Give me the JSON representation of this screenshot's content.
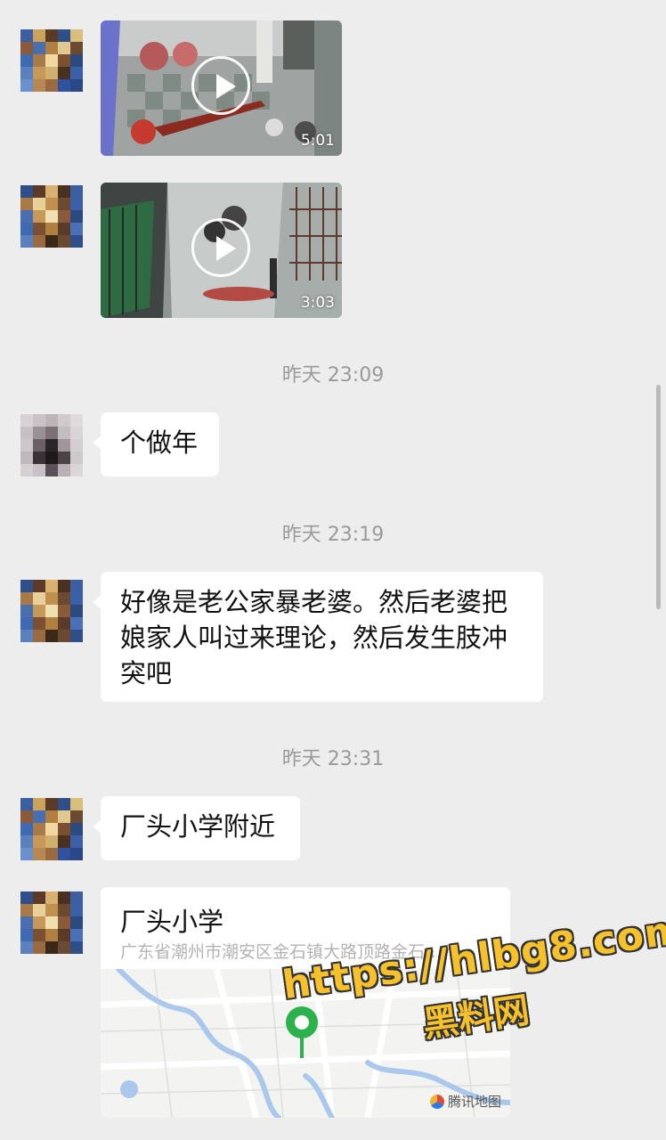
{
  "messages": {
    "videos": [
      {
        "duration": "5:01"
      },
      {
        "duration": "3:03"
      }
    ],
    "timestamps": [
      "昨天 23:09",
      "昨天 23:19",
      "昨天 23:31"
    ],
    "texts": [
      "个做年",
      "好像是老公家暴老婆。然后老婆把娘家人叫过来理论，然后发生肢冲突吧",
      "厂头小学附近"
    ],
    "location": {
      "name": "厂头小学",
      "address": "广东省潮州市潮安区金石镇大路顶路金石…",
      "map_provider": "腾讯地图"
    }
  },
  "watermark": {
    "url": "https://hlbg8.com",
    "name": "黑料网"
  },
  "colors": {
    "background": "#ededed",
    "bubble": "#ffffff",
    "timestamp": "#9a9a9a",
    "watermark": "#f6c12b"
  },
  "icons": [
    "play-icon",
    "location-pin-icon",
    "tencent-map-logo-icon"
  ]
}
